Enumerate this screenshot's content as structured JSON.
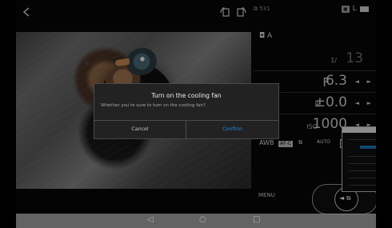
{
  "statusbar": {
    "small_text": "⧉ 531",
    "badge_text": "▣",
    "mode_text": "L"
  },
  "camera_panel": {
    "mode": "◘ A",
    "shutter_prefix": "1/",
    "shutter_value": "13",
    "aperture_prefix": "F",
    "aperture_value": "6.3",
    "ev_prefix": "⊞",
    "ev_value": "±0.0",
    "iso_prefix": "ISO",
    "iso_value": "1000",
    "wb": "AWB",
    "afc": "AF-C",
    "iso_auto": "AUTO",
    "menu": "MENU"
  },
  "dialog": {
    "title": "Turn on the cooling fan",
    "message": "Whether you're sure to turn on the cooling fan?",
    "cancel": "Cancel",
    "confirm": "Confirm"
  },
  "nav": {
    "back": "◁",
    "home": "○",
    "recent": "□"
  },
  "icons": {
    "left_arrow": "←",
    "arrow_left": "◄",
    "arrow_right": "►",
    "shutter_icon": "◄ ⧉"
  },
  "colors": {
    "accent": "#1f8ae8",
    "dialog_bg": "#222222",
    "panel_bg": "#080808",
    "nav_bg": "#777777"
  }
}
